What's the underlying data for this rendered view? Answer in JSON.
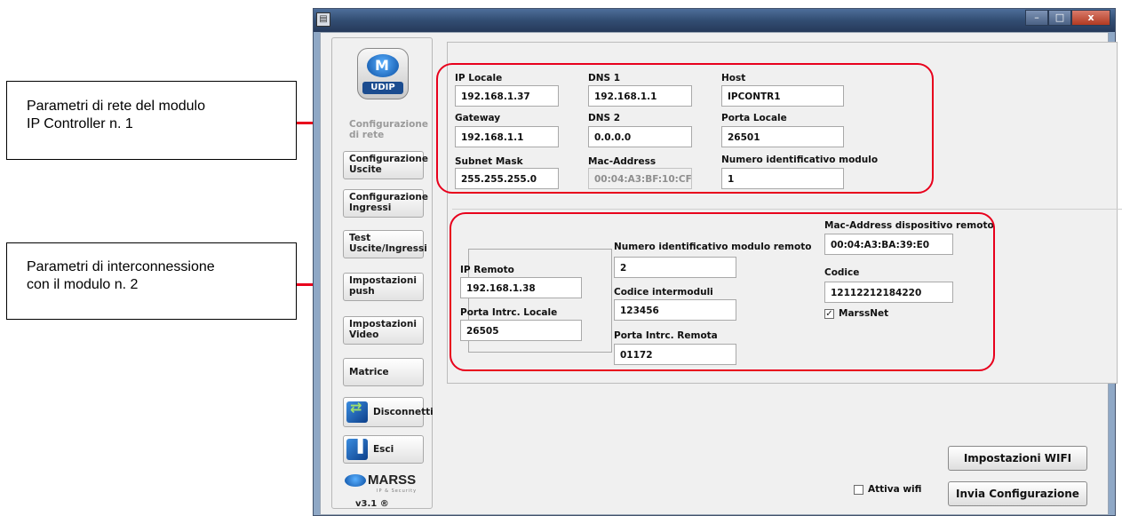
{
  "callouts": [
    {
      "lines": [
        "Parametri di rete del modulo",
        "IP Controller n. 1"
      ]
    },
    {
      "lines": [
        "Parametri di interconnessione",
        "con il modulo n. 2"
      ]
    }
  ],
  "window": {
    "title_icon": "app-icon",
    "controls": [
      "–",
      "□",
      "x"
    ]
  },
  "sidebar": {
    "logo": "UDIP",
    "items": [
      {
        "label": "Configurazione di rete"
      },
      {
        "label": "Configurazione Uscite"
      },
      {
        "label": "Configurazione Ingressi"
      },
      {
        "label": "Test Uscite/Ingressi"
      },
      {
        "label": "Impostazioni push"
      },
      {
        "label": "Impostazioni Video"
      },
      {
        "label": "Matrice"
      },
      {
        "label": "Disconnetti"
      },
      {
        "label": "Esci"
      }
    ],
    "brand": "MARSS",
    "brand_sub": "IP & Security",
    "version": "v3.1 ®"
  },
  "network": {
    "ip_locale": {
      "label": "IP Locale",
      "value": "192.168.1.37"
    },
    "dns1": {
      "label": "DNS 1",
      "value": "192.168.1.1"
    },
    "host": {
      "label": "Host",
      "value": "IPCONTR1"
    },
    "gateway": {
      "label": "Gateway",
      "value": "192.168.1.1"
    },
    "dns2": {
      "label": "DNS 2",
      "value": "0.0.0.0"
    },
    "porta_locale": {
      "label": "Porta Locale",
      "value": "26501"
    },
    "subnet": {
      "label": "Subnet Mask",
      "value": "255.255.255.0"
    },
    "mac": {
      "label": "Mac-Address",
      "value": "00:04:A3:BF:10:CF"
    },
    "num_modulo": {
      "label": "Numero identificativo modulo",
      "value": "1"
    }
  },
  "interconnect": {
    "ip_remoto": {
      "label": "IP Remoto",
      "value": "192.168.1.38"
    },
    "porta_intrc_locale": {
      "label": "Porta Intrc. Locale",
      "value": "26505"
    },
    "num_modulo_remoto": {
      "label": "Numero identificativo modulo remoto",
      "value": "2"
    },
    "codice_intermoduli": {
      "label": "Codice intermoduli",
      "value": "123456"
    },
    "porta_intrc_remota": {
      "label": "Porta Intrc. Remota",
      "value": "01172"
    },
    "mac_remoto": {
      "label": "Mac-Address dispositivo remoto",
      "value": "00:04:A3:BA:39:E0"
    },
    "codice": {
      "label": "Codice",
      "value": "12112212184220"
    },
    "marssnet": {
      "label": "MarssNet",
      "mark": "✓",
      "checked": true
    }
  },
  "footer": {
    "wifi_label": "Attiva wifi",
    "wifi_checked": false,
    "btn_wifi": "Impostazioni WIFI",
    "btn_send": "Invia Configurazione"
  },
  "colors": {
    "highlight": "#e8001c",
    "accent": "#0a4ea2"
  }
}
